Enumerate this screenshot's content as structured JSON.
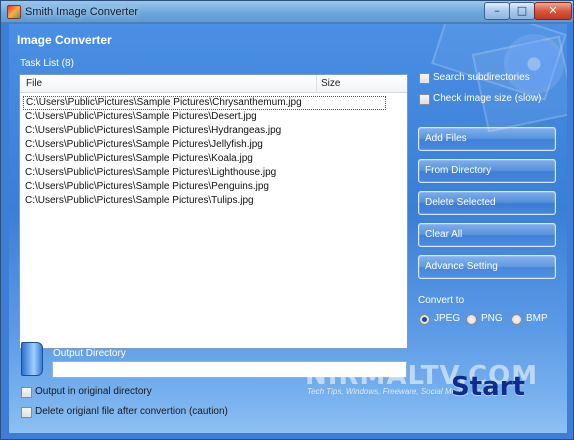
{
  "window": {
    "title": "Smith Image Converter",
    "controls": {
      "minimize": "–",
      "maximize": "□",
      "close": "✕"
    }
  },
  "header": {
    "title": "Image Converter"
  },
  "task_list": {
    "label": "Task List (8)",
    "columns": [
      "File",
      "Size"
    ],
    "rows": [
      "C:\\Users\\Public\\Pictures\\Sample Pictures\\Chrysanthemum.jpg",
      "C:\\Users\\Public\\Pictures\\Sample Pictures\\Desert.jpg",
      "C:\\Users\\Public\\Pictures\\Sample Pictures\\Hydrangeas.jpg",
      "C:\\Users\\Public\\Pictures\\Sample Pictures\\Jellyfish.jpg",
      "C:\\Users\\Public\\Pictures\\Sample Pictures\\Koala.jpg",
      "C:\\Users\\Public\\Pictures\\Sample Pictures\\Lighthouse.jpg",
      "C:\\Users\\Public\\Pictures\\Sample Pictures\\Penguins.jpg",
      "C:\\Users\\Public\\Pictures\\Sample Pictures\\Tulips.jpg"
    ]
  },
  "options": {
    "search_subdirectories": {
      "label": "Search subdirectories",
      "checked": false
    },
    "check_image_size": {
      "label": "Check image size (slow)",
      "checked": false
    }
  },
  "actions": {
    "add_files": "Add Files",
    "from_directory": "From Directory",
    "delete_selected": "Delete Selected",
    "clear_all": "Clear All",
    "advance_setting": "Advance Setting"
  },
  "convert": {
    "label": "Convert to",
    "formats": [
      "JPEG",
      "PNG",
      "BMP"
    ],
    "selected": "JPEG"
  },
  "output": {
    "label": "Output Directory",
    "value": "",
    "output_in_original": {
      "label": "Output in original directory",
      "checked": false
    },
    "delete_original": {
      "label": "Delete origianl file after convertion (caution)",
      "checked": false
    }
  },
  "watermark": {
    "brand": "NIRMALTV.COM",
    "tagline": "Tech Tips, Windows, Freeware, Social Media, Internet"
  },
  "start_button": "Start",
  "colors": {
    "client_blue": "#3d7fd6",
    "start_text": "#0d2c8e"
  }
}
